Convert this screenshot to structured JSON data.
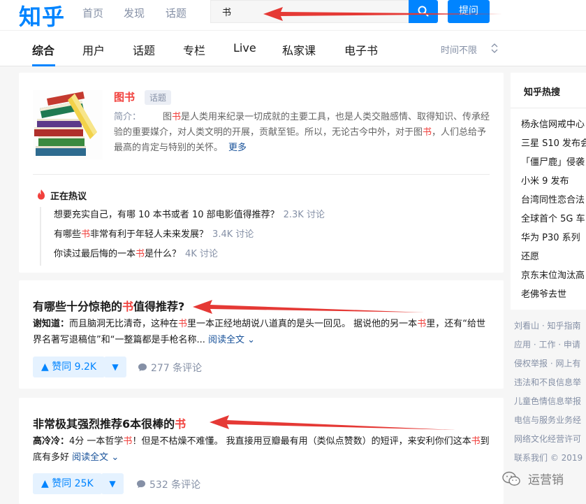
{
  "header": {
    "logo": "知乎",
    "nav": [
      "首页",
      "发现",
      "话题"
    ],
    "search_value": "书",
    "ask_label": "提问"
  },
  "tabs": [
    "综合",
    "用户",
    "话题",
    "专栏",
    "Live",
    "私家课",
    "电子书"
  ],
  "time_filter": "时间不限",
  "topic": {
    "title": "图书",
    "tag": "话题",
    "desc_label": "简介：",
    "desc_pre": "图",
    "desc_hl1": "书",
    "desc_mid": "是人类用来纪录一切成就的主要工具，也是人类交融感情、取得知识、传承经验的重要媒介，对人类文明的开展，贡献至钜。所以，无论古今中外，对于图",
    "desc_hl2": "书",
    "desc_post": "，人们总给予最高的肯定与特别的关怀。",
    "more": "更多",
    "hot_title": "正在热议",
    "hot_items": [
      {
        "pre": "想要充实自己，有哪 10 本书或者 10 部电影值得推荐？",
        "hl": "",
        "post": "",
        "count": "2.3K 讨论"
      },
      {
        "pre": "有哪些",
        "hl": "书",
        "post": "非常有利于年轻人未来发展？",
        "count": "3.4K 讨论"
      },
      {
        "pre": "你读过最后悔的一本",
        "hl": "书",
        "post": "是什么？",
        "count": "4K 讨论"
      }
    ]
  },
  "answers": [
    {
      "title_pre": "有哪些十分惊艳的",
      "title_hl": "书",
      "title_post": "值得推荐?",
      "author": "谢知道：",
      "body_a": "而且脑洞无比清奇，这种在",
      "body_hl1": "书",
      "body_b": "里一本正经地胡说八道真的是头一回见。 据说他的另一本",
      "body_hl2": "书",
      "body_c": "里，还有“给世界名著写退稿信”和“一整篇都是手枪名称...",
      "read_more": "阅读全文",
      "vote": "▲ 赞同 9.2K",
      "down": "▼",
      "comments": "277 条评论"
    },
    {
      "title_pre": "非常极其强烈推荐6本很棒的",
      "title_hl": "书",
      "title_post": "",
      "author": "高冷冷：",
      "body_a": "4分 一本哲学",
      "body_hl1": "书",
      "body_b": "！但是不枯燥不难懂。 我直接用豆瓣最有用（类似点赞数）的短评，来安利你们这本",
      "body_hl2": "书",
      "body_c": "到底有多好",
      "read_more": "阅读全文",
      "vote": "▲ 赞同 25K",
      "down": "▼",
      "comments": "532 条评论"
    }
  ],
  "sidebar": {
    "title": "知乎热搜",
    "items": [
      "杨永信网戒中心",
      "三星 S10 发布会",
      "「僵尸鹿」侵袭",
      "小米 9 发布",
      "台湾同性恋合法",
      "全球首个 5G 车",
      "华为 P30 系列",
      "还愿",
      "京东末位淘汰高",
      "老佛爷去世"
    ]
  },
  "footer": [
    "刘看山 · 知乎指南",
    "应用 · 工作 · 申请",
    "侵权举报 · 网上有",
    "违法和不良信息举",
    "儿童色情信息举报",
    "电信与服务业务经",
    "网络文化经营许可",
    "联系我们 © 2019"
  ],
  "watermark": "运营销",
  "colors": {
    "brand": "#0084ff",
    "highlight": "#f1403c",
    "annotation_arrow": "#e53935"
  }
}
